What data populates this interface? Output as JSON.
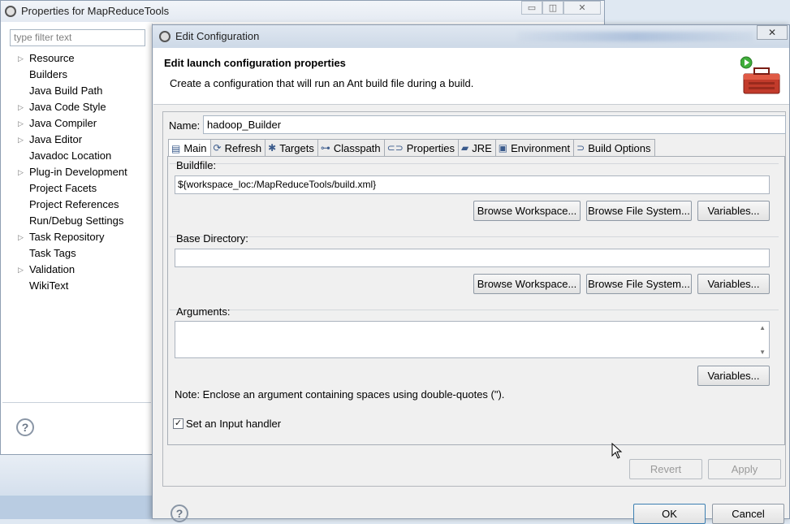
{
  "back_window": {
    "title": "Properties for MapReduceTools",
    "filter_placeholder": "type filter text",
    "tree": [
      {
        "label": "Resource",
        "expandable": true
      },
      {
        "label": "Builders",
        "expandable": false,
        "selected": true
      },
      {
        "label": "Java Build Path",
        "expandable": false
      },
      {
        "label": "Java Code Style",
        "expandable": true
      },
      {
        "label": "Java Compiler",
        "expandable": true
      },
      {
        "label": "Java Editor",
        "expandable": true
      },
      {
        "label": "Javadoc Location",
        "expandable": false
      },
      {
        "label": "Plug-in Development",
        "expandable": true
      },
      {
        "label": "Project Facets",
        "expandable": false
      },
      {
        "label": "Project References",
        "expandable": false
      },
      {
        "label": "Run/Debug Settings",
        "expandable": false
      },
      {
        "label": "Task Repository",
        "expandable": true
      },
      {
        "label": "Task Tags",
        "expandable": false
      },
      {
        "label": "Validation",
        "expandable": true
      },
      {
        "label": "WikiText",
        "expandable": false
      }
    ],
    "help_glyph": "?"
  },
  "dialog": {
    "title": "Edit Configuration",
    "close_glyph": "✕",
    "banner_heading": "Edit launch configuration properties",
    "banner_description": "Create a configuration that will run an Ant build file during a build.",
    "name_label": "Name:",
    "name_value": "hadoop_Builder",
    "tabs": [
      {
        "label": "Main",
        "icon": "main-tab-icon",
        "glyph": "▤",
        "active": true
      },
      {
        "label": "Refresh",
        "icon": "refresh-icon",
        "glyph": "⟳"
      },
      {
        "label": "Targets",
        "icon": "targets-icon",
        "glyph": "✱"
      },
      {
        "label": "Classpath",
        "icon": "classpath-icon",
        "glyph": "⊶"
      },
      {
        "label": "Properties",
        "icon": "properties-icon",
        "glyph": "⊂⊃"
      },
      {
        "label": "JRE",
        "icon": "jre-icon",
        "glyph": "▰"
      },
      {
        "label": "Environment",
        "icon": "environment-icon",
        "glyph": "▣"
      },
      {
        "label": "Build Options",
        "icon": "build-options-icon",
        "glyph": "⊃"
      }
    ],
    "buildfile_label": "Buildfile:",
    "buildfile_value": "${workspace_loc:/MapReduceTools/build.xml}",
    "base_dir_label": "Base Directory:",
    "base_dir_value": "",
    "arguments_label": "Arguments:",
    "arguments_value": "",
    "browse_workspace": "Browse Workspace...",
    "browse_file_system": "Browse File System...",
    "variables": "Variables...",
    "note": "Note: Enclose an argument containing spaces using double-quotes (\").",
    "input_handler_label": "Set an Input handler",
    "input_handler_checked": true,
    "revert": "Revert",
    "apply": "Apply",
    "ok": "OK",
    "cancel": "Cancel",
    "help_glyph": "?"
  }
}
